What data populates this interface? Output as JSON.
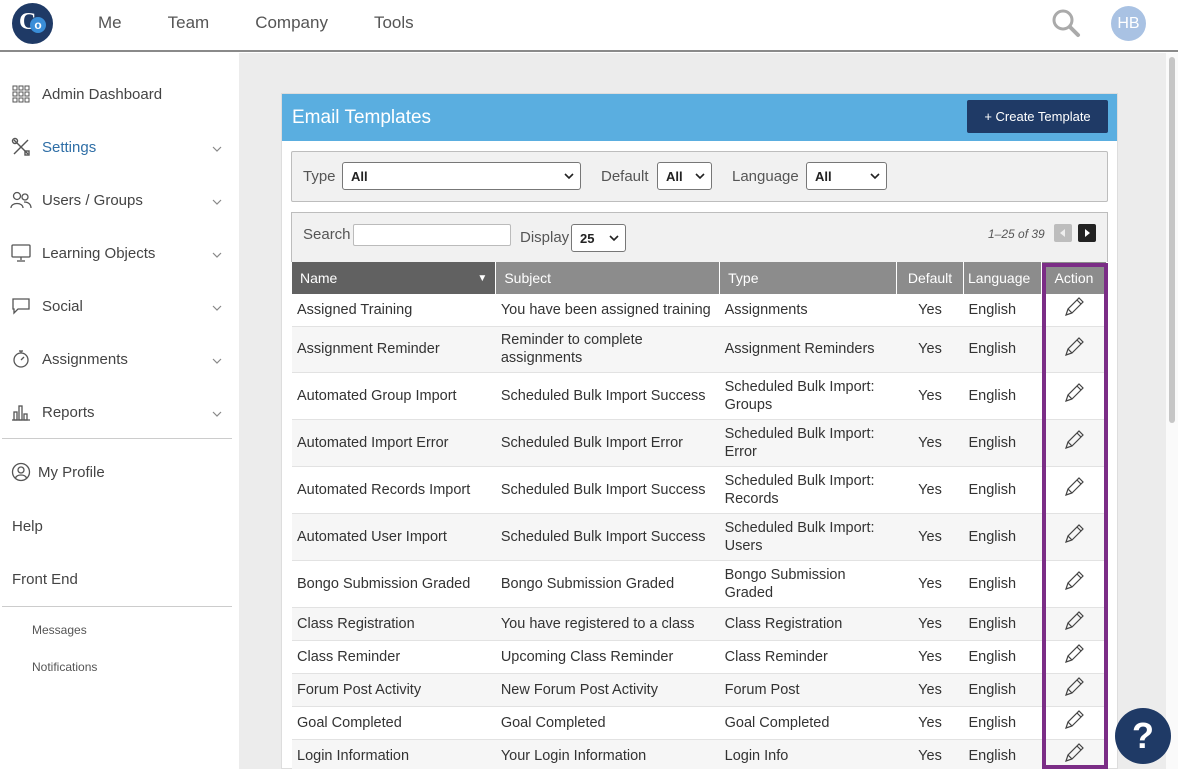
{
  "brand": {
    "logo_c": "C",
    "logo_o": "o"
  },
  "topnav": {
    "items": [
      "Me",
      "Team",
      "Company",
      "Tools"
    ]
  },
  "user": {
    "initials": "HB"
  },
  "sidebar": {
    "items": [
      {
        "label": "Admin Dashboard",
        "icon": "grid-icon"
      },
      {
        "label": "Settings",
        "icon": "tools-icon"
      },
      {
        "label": "Users / Groups",
        "icon": "users-icon"
      },
      {
        "label": "Learning Objects",
        "icon": "monitor-icon"
      },
      {
        "label": "Social",
        "icon": "speech-bubble-icon"
      },
      {
        "label": "Assignments",
        "icon": "stopwatch-icon"
      },
      {
        "label": "Reports",
        "icon": "bar-chart-icon"
      }
    ],
    "my_profile": "My Profile",
    "help": "Help",
    "front_end": "Front End",
    "messages": "Messages",
    "notifications": "Notifications"
  },
  "panel": {
    "title": "Email Templates",
    "create_label": "+ Create Template"
  },
  "filters": {
    "type_label": "Type",
    "type_value": "All",
    "default_label": "Default",
    "default_value": "All",
    "language_label": "Language",
    "language_value": "All"
  },
  "search": {
    "label": "Search",
    "value": "",
    "display_label": "Display",
    "display_value": "25",
    "pager_text": "1–25 of 39"
  },
  "table": {
    "headers": {
      "name": "Name",
      "subject": "Subject",
      "type": "Type",
      "default": "Default",
      "language": "Language",
      "action": "Action"
    },
    "rows": [
      {
        "name": "Assigned Training",
        "subject": "You have been assigned training",
        "type": "Assignments",
        "default": "Yes",
        "language": "English"
      },
      {
        "name": "Assignment Reminder",
        "subject": "Reminder to complete assignments",
        "type": "Assignment Reminders",
        "default": "Yes",
        "language": "English"
      },
      {
        "name": "Automated Group Import",
        "subject": "Scheduled Bulk Import Success",
        "type": "Scheduled Bulk Import: Groups",
        "default": "Yes",
        "language": "English"
      },
      {
        "name": "Automated Import Error",
        "subject": "Scheduled Bulk Import Error",
        "type": "Scheduled Bulk Import: Error",
        "default": "Yes",
        "language": "English"
      },
      {
        "name": "Automated Records Import",
        "subject": "Scheduled Bulk Import Success",
        "type": "Scheduled Bulk Import: Records",
        "default": "Yes",
        "language": "English"
      },
      {
        "name": "Automated User Import",
        "subject": "Scheduled Bulk Import Success",
        "type": "Scheduled Bulk Import: Users",
        "default": "Yes",
        "language": "English"
      },
      {
        "name": "Bongo Submission Graded",
        "subject": "Bongo Submission Graded",
        "type": "Bongo Submission Graded",
        "default": "Yes",
        "language": "English"
      },
      {
        "name": "Class Registration",
        "subject": "You have registered to a class",
        "type": "Class Registration",
        "default": "Yes",
        "language": "English"
      },
      {
        "name": "Class Reminder",
        "subject": "Upcoming Class Reminder",
        "type": "Class Reminder",
        "default": "Yes",
        "language": "English"
      },
      {
        "name": "Forum Post Activity",
        "subject": "New Forum Post Activity",
        "type": "Forum Post",
        "default": "Yes",
        "language": "English"
      },
      {
        "name": "Goal Completed",
        "subject": "Goal Completed",
        "type": "Goal Completed",
        "default": "Yes",
        "language": "English"
      },
      {
        "name": "Login Information",
        "subject": "Your Login Information",
        "type": "Login Info",
        "default": "Yes",
        "language": "English"
      }
    ]
  },
  "help_fab": "?",
  "colors": {
    "header_blue": "#5aaee0",
    "navy": "#1f3a66",
    "highlight_purple": "#7b2d86"
  }
}
